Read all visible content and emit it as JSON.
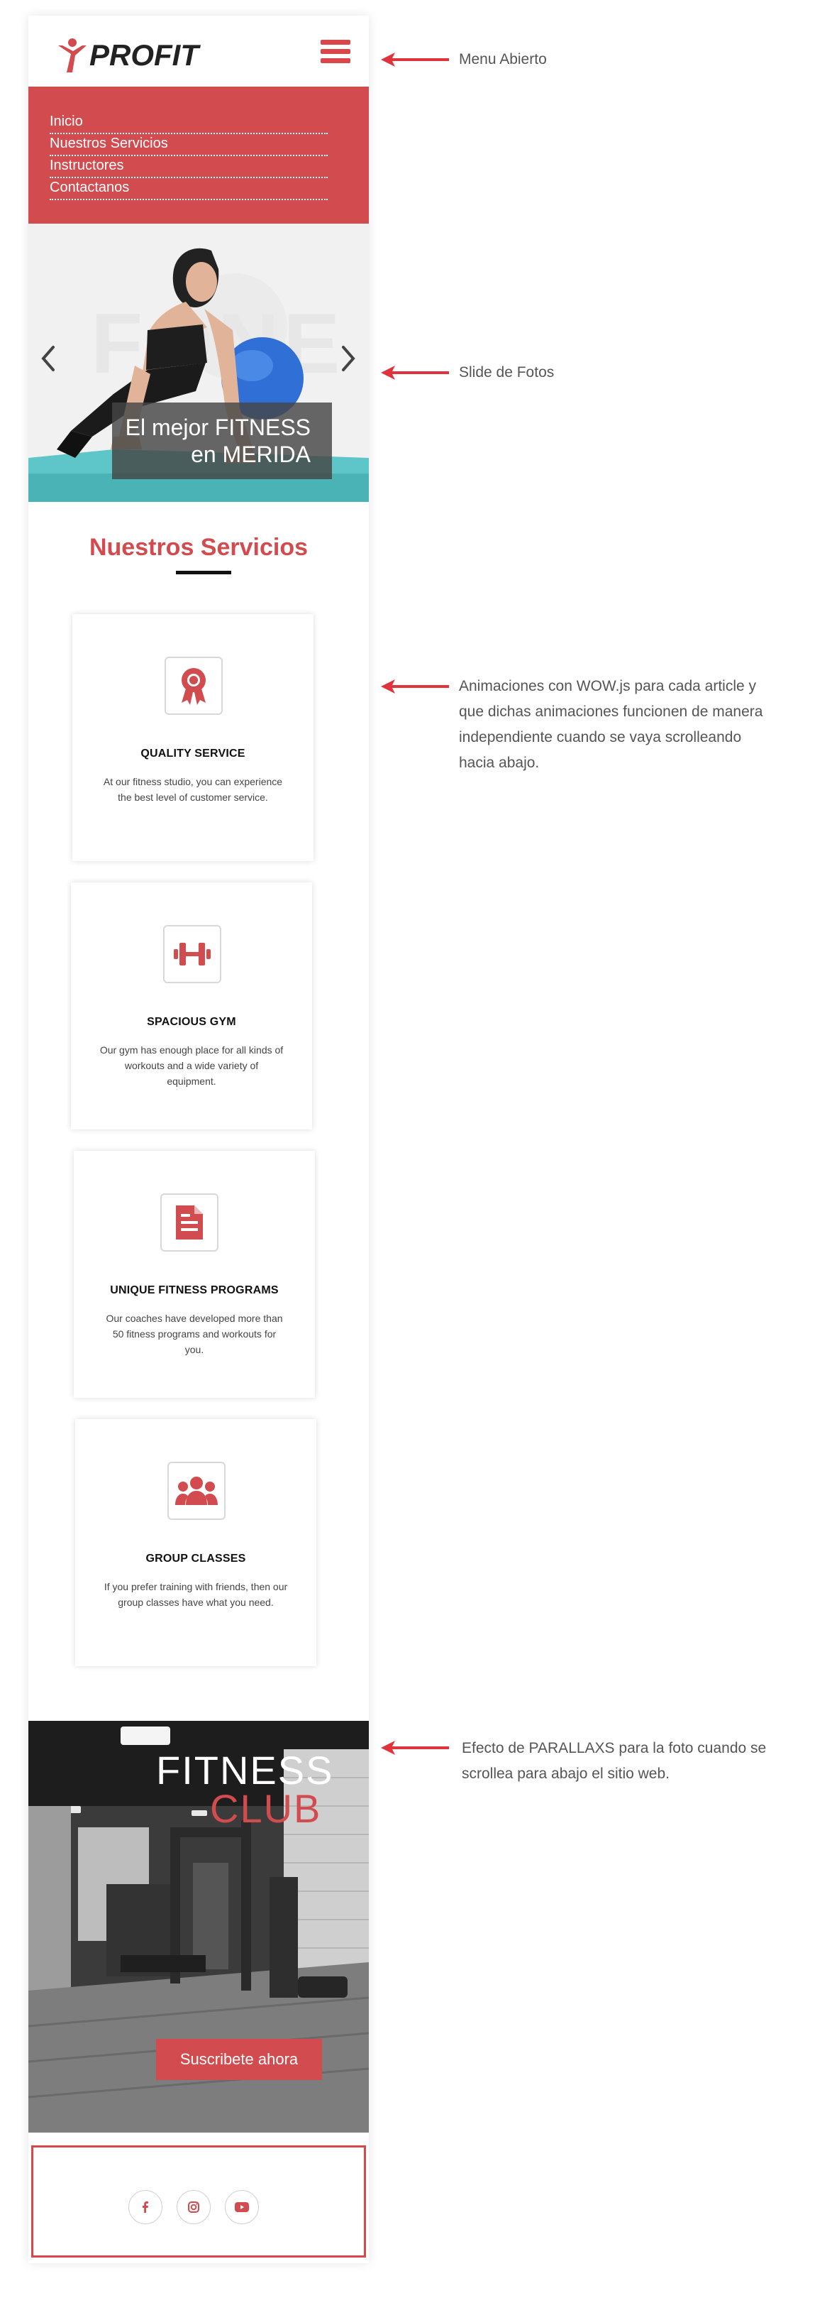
{
  "header": {
    "logo_text": "PROFIT",
    "menu_icon": "hamburger-icon"
  },
  "menu": {
    "items": [
      "Inicio",
      "Nuestros Servicios",
      "Instructores",
      "Contactanos"
    ]
  },
  "slider": {
    "background_word": "FONE",
    "caption_line1": "El mejor FITNESS",
    "caption_line2": "en MERIDA",
    "prev_icon": "chevron-left-icon",
    "next_icon": "chevron-right-icon"
  },
  "services": {
    "title": "Nuestros Servicios",
    "cards": [
      {
        "icon": "award-icon",
        "title": "QUALITY SERVICE",
        "text": "At our fitness studio, you can experience the best level of customer service."
      },
      {
        "icon": "dumbbell-icon",
        "title": "SPACIOUS GYM",
        "text": "Our gym has enough place for all kinds of workouts and a wide variety of equipment."
      },
      {
        "icon": "document-icon",
        "title": "UNIQUE FITNESS PROGRAMS",
        "text": "Our coaches have developed more than 50 fitness programs and workouts for you."
      },
      {
        "icon": "group-icon",
        "title": "GROUP CLASSES",
        "text": "If you prefer training with friends, then our group classes have what you need."
      }
    ]
  },
  "parallax": {
    "title_line1": "FITNESS",
    "title_line2": "CLUB",
    "button": "Suscribete ahora"
  },
  "footer": {
    "social": [
      "facebook-icon",
      "instagram-icon",
      "youtube-icon"
    ]
  },
  "annotations": {
    "menu": "Menu Abierto",
    "slider": "Slide de Fotos",
    "wow": [
      "Animaciones con WOW.js para cada article y",
      "que dichas animaciones funcionen de manera",
      "independiente cuando se vaya scrolleando",
      "hacia abajo."
    ],
    "parallax": [
      "Efecto de PARALLAXS para la foto cuando se",
      "scrollea para abajo el sitio web."
    ]
  },
  "colors": {
    "accent": "#d24b4e",
    "arrow": "#e0343d"
  }
}
